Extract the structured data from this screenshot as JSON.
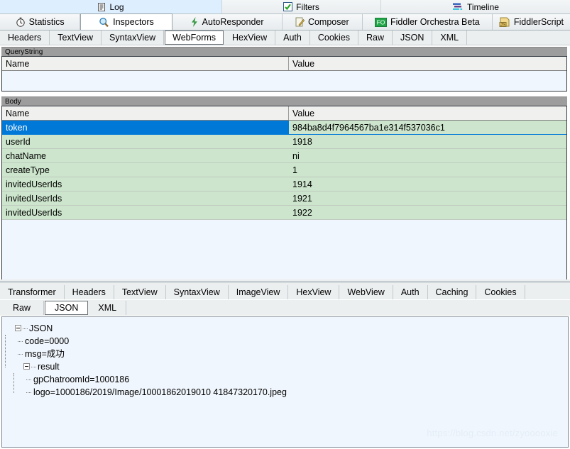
{
  "window": {
    "watermark": "https://blog.csdn.net/zyooooxie"
  },
  "top_row1": [
    {
      "label": "Log",
      "icon": "log-icon",
      "selected": true
    },
    {
      "label": "Filters",
      "icon": "filters-checkbox-icon",
      "selected": false
    },
    {
      "label": "Timeline",
      "icon": "timeline-icon",
      "selected": false
    }
  ],
  "top_row2": [
    {
      "label": "Statistics",
      "icon": "stopwatch-icon",
      "active": false
    },
    {
      "label": "Inspectors",
      "icon": "magnifier-icon",
      "active": true
    },
    {
      "label": "AutoResponder",
      "icon": "lightning-icon",
      "active": false
    },
    {
      "label": "Composer",
      "icon": "compose-pencil-icon",
      "active": false
    },
    {
      "label": "Fiddler Orchestra Beta",
      "icon": "fo-badge-icon",
      "active": false
    },
    {
      "label": "FiddlerScript",
      "icon": "js-script-icon",
      "active": false
    }
  ],
  "request_tabs": {
    "items": [
      {
        "label": "Headers",
        "active": false
      },
      {
        "label": "TextView",
        "active": false
      },
      {
        "label": "SyntaxView",
        "active": false
      },
      {
        "label": "WebForms",
        "active": true
      },
      {
        "label": "HexView",
        "active": false
      },
      {
        "label": "Auth",
        "active": false
      },
      {
        "label": "Cookies",
        "active": false
      },
      {
        "label": "Raw",
        "active": false
      },
      {
        "label": "JSON",
        "active": false
      },
      {
        "label": "XML",
        "active": false
      }
    ]
  },
  "querystring": {
    "title": "QueryString",
    "columns": [
      "Name",
      "Value"
    ],
    "rows": []
  },
  "body": {
    "title": "Body",
    "columns": [
      "Name",
      "Value"
    ],
    "rows": [
      {
        "name": "token",
        "value": "984ba8d4f7964567ba1e314f537036c1",
        "selected": true
      },
      {
        "name": "userId",
        "value": "1918",
        "selected": false
      },
      {
        "name": "chatName",
        "value": "ni",
        "selected": false
      },
      {
        "name": "createType",
        "value": "1",
        "selected": false
      },
      {
        "name": "invitedUserIds",
        "value": "1914",
        "selected": false
      },
      {
        "name": "invitedUserIds",
        "value": "1921",
        "selected": false
      },
      {
        "name": "invitedUserIds",
        "value": "1922",
        "selected": false
      }
    ]
  },
  "response_tabs": {
    "row1": [
      {
        "label": "Transformer",
        "active": false
      },
      {
        "label": "Headers",
        "active": false
      },
      {
        "label": "TextView",
        "active": false
      },
      {
        "label": "SyntaxView",
        "active": false
      },
      {
        "label": "ImageView",
        "active": false
      },
      {
        "label": "HexView",
        "active": false
      },
      {
        "label": "WebView",
        "active": false
      },
      {
        "label": "Auth",
        "active": false
      },
      {
        "label": "Caching",
        "active": false
      },
      {
        "label": "Cookies",
        "active": false
      }
    ],
    "row2": [
      {
        "label": "Raw",
        "active": false
      },
      {
        "label": "JSON",
        "active": true
      },
      {
        "label": "XML",
        "active": false
      }
    ]
  },
  "json_tree": {
    "root": "JSON",
    "nodes": [
      {
        "text": "code=0000",
        "depth": 1,
        "expandable": false
      },
      {
        "text": "msg=成功",
        "depth": 1,
        "expandable": false
      },
      {
        "text": "result",
        "depth": 1,
        "expandable": true
      },
      {
        "text": "gpChatroomId=1000186",
        "depth": 2,
        "expandable": false
      },
      {
        "text": "logo=1000186/2019/Image/10001862019010 41847320170.jpeg",
        "depth": 2,
        "expandable": false
      }
    ]
  }
}
